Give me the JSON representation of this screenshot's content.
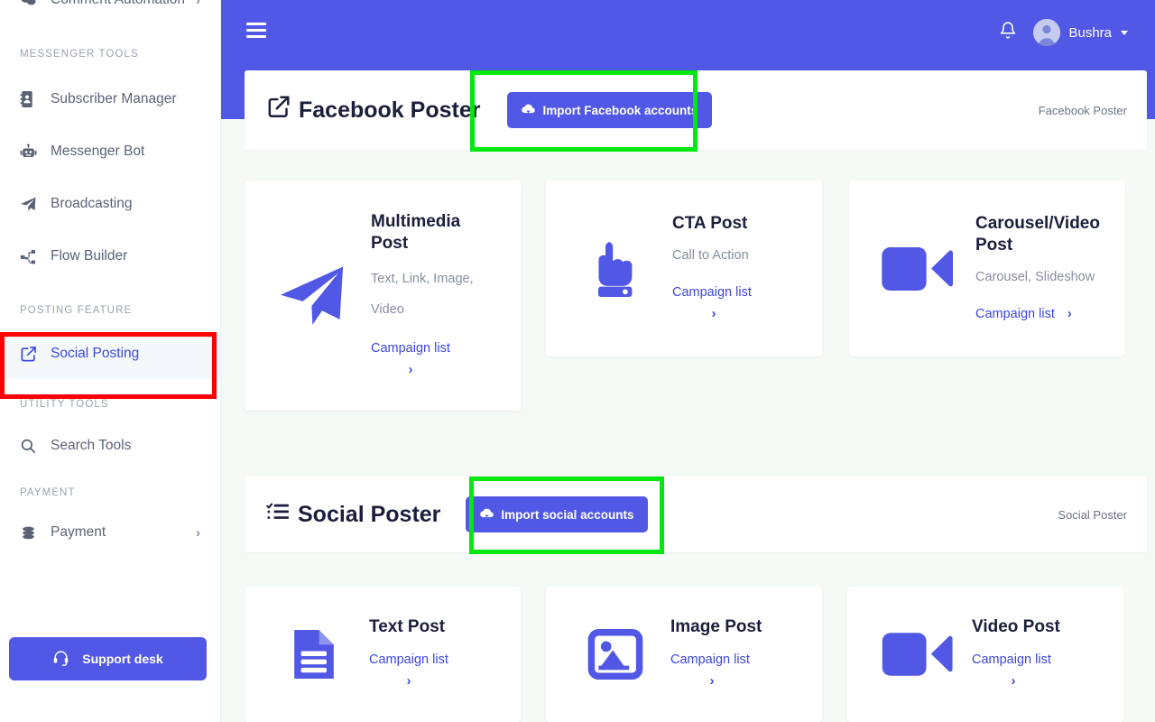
{
  "sidebar": {
    "items_top": [
      {
        "label": "Comment Automation",
        "icon": "comments-icon",
        "chevron": "›"
      }
    ],
    "sections": [
      {
        "label": "MESSENGER TOOLS",
        "items": [
          {
            "label": "Subscriber Manager",
            "icon": "address-book-icon"
          },
          {
            "label": "Messenger Bot",
            "icon": "robot-icon"
          },
          {
            "label": "Broadcasting",
            "icon": "paper-plane-icon"
          },
          {
            "label": "Flow Builder",
            "icon": "sitemap-icon"
          }
        ]
      },
      {
        "label": "POSTING FEATURE",
        "items": [
          {
            "label": "Social Posting",
            "icon": "share-square-icon",
            "active": true
          }
        ]
      },
      {
        "label": "UTILITY TOOLS",
        "items": [
          {
            "label": "Search Tools",
            "icon": "search-icon"
          }
        ]
      },
      {
        "label": "PAYMENT",
        "items": [
          {
            "label": "Payment",
            "icon": "coins-icon",
            "chevron": "›"
          }
        ]
      }
    ],
    "support_button": {
      "label": "Support desk",
      "icon": "headset-icon"
    }
  },
  "topbar": {
    "menu_icon": "hamburger-icon",
    "notification_icon": "bell-icon",
    "user_name": "Bushra",
    "avatar_icon": "user-avatar-icon",
    "caret_icon": "chevron-down-icon"
  },
  "facebook_poster": {
    "title": "Facebook Poster",
    "title_icon": "share-square-icon",
    "import_button": {
      "label": "Import Facebook accounts",
      "icon": "cloud-download-icon"
    },
    "breadcrumb": "Facebook Poster",
    "cards": [
      {
        "title": "Multimedia Post",
        "desc": "Text, Link, Image, Video",
        "link": "Campaign list",
        "arrow": "›",
        "icon": "paper-plane-icon"
      },
      {
        "title": "CTA Post",
        "desc": "Call to Action",
        "link": "Campaign list",
        "arrow": "›",
        "icon": "hand-pointer-icon"
      },
      {
        "title": "Carousel/Video Post",
        "desc": "Carousel, Slideshow",
        "link": "Campaign list",
        "arrow": "›",
        "icon": "video-camera-icon"
      }
    ]
  },
  "social_poster": {
    "title": "Social Poster",
    "title_icon": "tasks-icon",
    "import_button": {
      "label": "Import social accounts",
      "icon": "cloud-download-icon"
    },
    "breadcrumb": "Social Poster",
    "cards": [
      {
        "title": "Text Post",
        "desc": "",
        "link": "Campaign list",
        "arrow": "›",
        "icon": "file-text-icon"
      },
      {
        "title": "Image Post",
        "desc": "",
        "link": "Campaign list",
        "arrow": "›",
        "icon": "image-icon"
      },
      {
        "title": "Video Post",
        "desc": "",
        "link": "Campaign list",
        "arrow": "›",
        "icon": "video-camera-icon"
      }
    ]
  },
  "colors": {
    "accent": "#5158e6",
    "link": "#3b46e0",
    "background": "#f6faf7",
    "highlight_green": "#00e810",
    "highlight_red": "#ff0000"
  }
}
